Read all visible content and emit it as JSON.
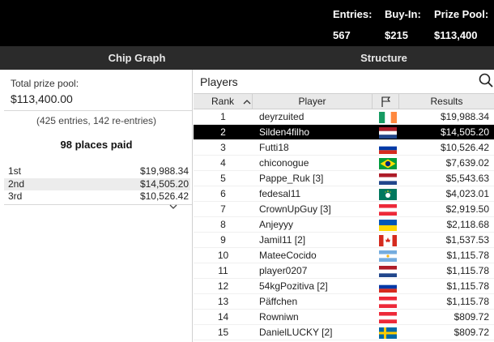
{
  "header": {
    "entries_label": "Entries:",
    "entries_value": "567",
    "buyin_label": "Buy-In:",
    "buyin_value": "$215",
    "pool_label": "Prize Pool:",
    "pool_value": "$113,400"
  },
  "tabs": {
    "chip_graph": "Chip Graph",
    "structure": "Structure"
  },
  "summary": {
    "prize_label": "Total prize pool:",
    "prize_value": "$113,400.00",
    "entries_info": "(425 entries, 142 re-entries)",
    "places_paid": "98 places paid",
    "payouts": [
      {
        "place": "1st",
        "amount": "$19,988.34"
      },
      {
        "place": "2nd",
        "amount": "$14,505.20"
      },
      {
        "place": "3rd",
        "amount": "$10,526.42"
      }
    ]
  },
  "players": {
    "search_placeholder": "Players",
    "columns": {
      "rank": "Rank",
      "player": "Player",
      "results": "Results"
    },
    "selected_rank": "2",
    "rows": [
      {
        "rank": "1",
        "name": "deyrzuited",
        "flag": "ireland",
        "result": "$19,988.34"
      },
      {
        "rank": "2",
        "name": "Silden4filho",
        "flag": "netherlands",
        "result": "$14,505.20"
      },
      {
        "rank": "3",
        "name": "Futti18",
        "flag": "russia",
        "result": "$10,526.42"
      },
      {
        "rank": "4",
        "name": "chiconogue",
        "flag": "brazil",
        "result": "$7,639.02"
      },
      {
        "rank": "5",
        "name": "Pappe_Ruk [3]",
        "flag": "netherlands",
        "result": "$5,543.63"
      },
      {
        "rank": "6",
        "name": "fedesal11",
        "flag": "macau",
        "result": "$4,023.01"
      },
      {
        "rank": "7",
        "name": "CrownUpGuy [3]",
        "flag": "austria",
        "result": "$2,919.50"
      },
      {
        "rank": "8",
        "name": "Anjeyyy",
        "flag": "ukraine",
        "result": "$2,118.68"
      },
      {
        "rank": "9",
        "name": "Jamil11 [2]",
        "flag": "canada",
        "result": "$1,537.53"
      },
      {
        "rank": "10",
        "name": "MateeCocido",
        "flag": "argentina",
        "result": "$1,115.78"
      },
      {
        "rank": "11",
        "name": "player0207",
        "flag": "netherlands",
        "result": "$1,115.78"
      },
      {
        "rank": "12",
        "name": "54kgPozitiva [2]",
        "flag": "russia",
        "result": "$1,115.78"
      },
      {
        "rank": "13",
        "name": "Päffchen",
        "flag": "austria",
        "result": "$1,115.78"
      },
      {
        "rank": "14",
        "name": "Rowniwn",
        "flag": "austria",
        "result": "$809.72"
      },
      {
        "rank": "15",
        "name": "DanielLUCKY [2]",
        "flag": "sweden",
        "result": "$809.72"
      }
    ]
  }
}
